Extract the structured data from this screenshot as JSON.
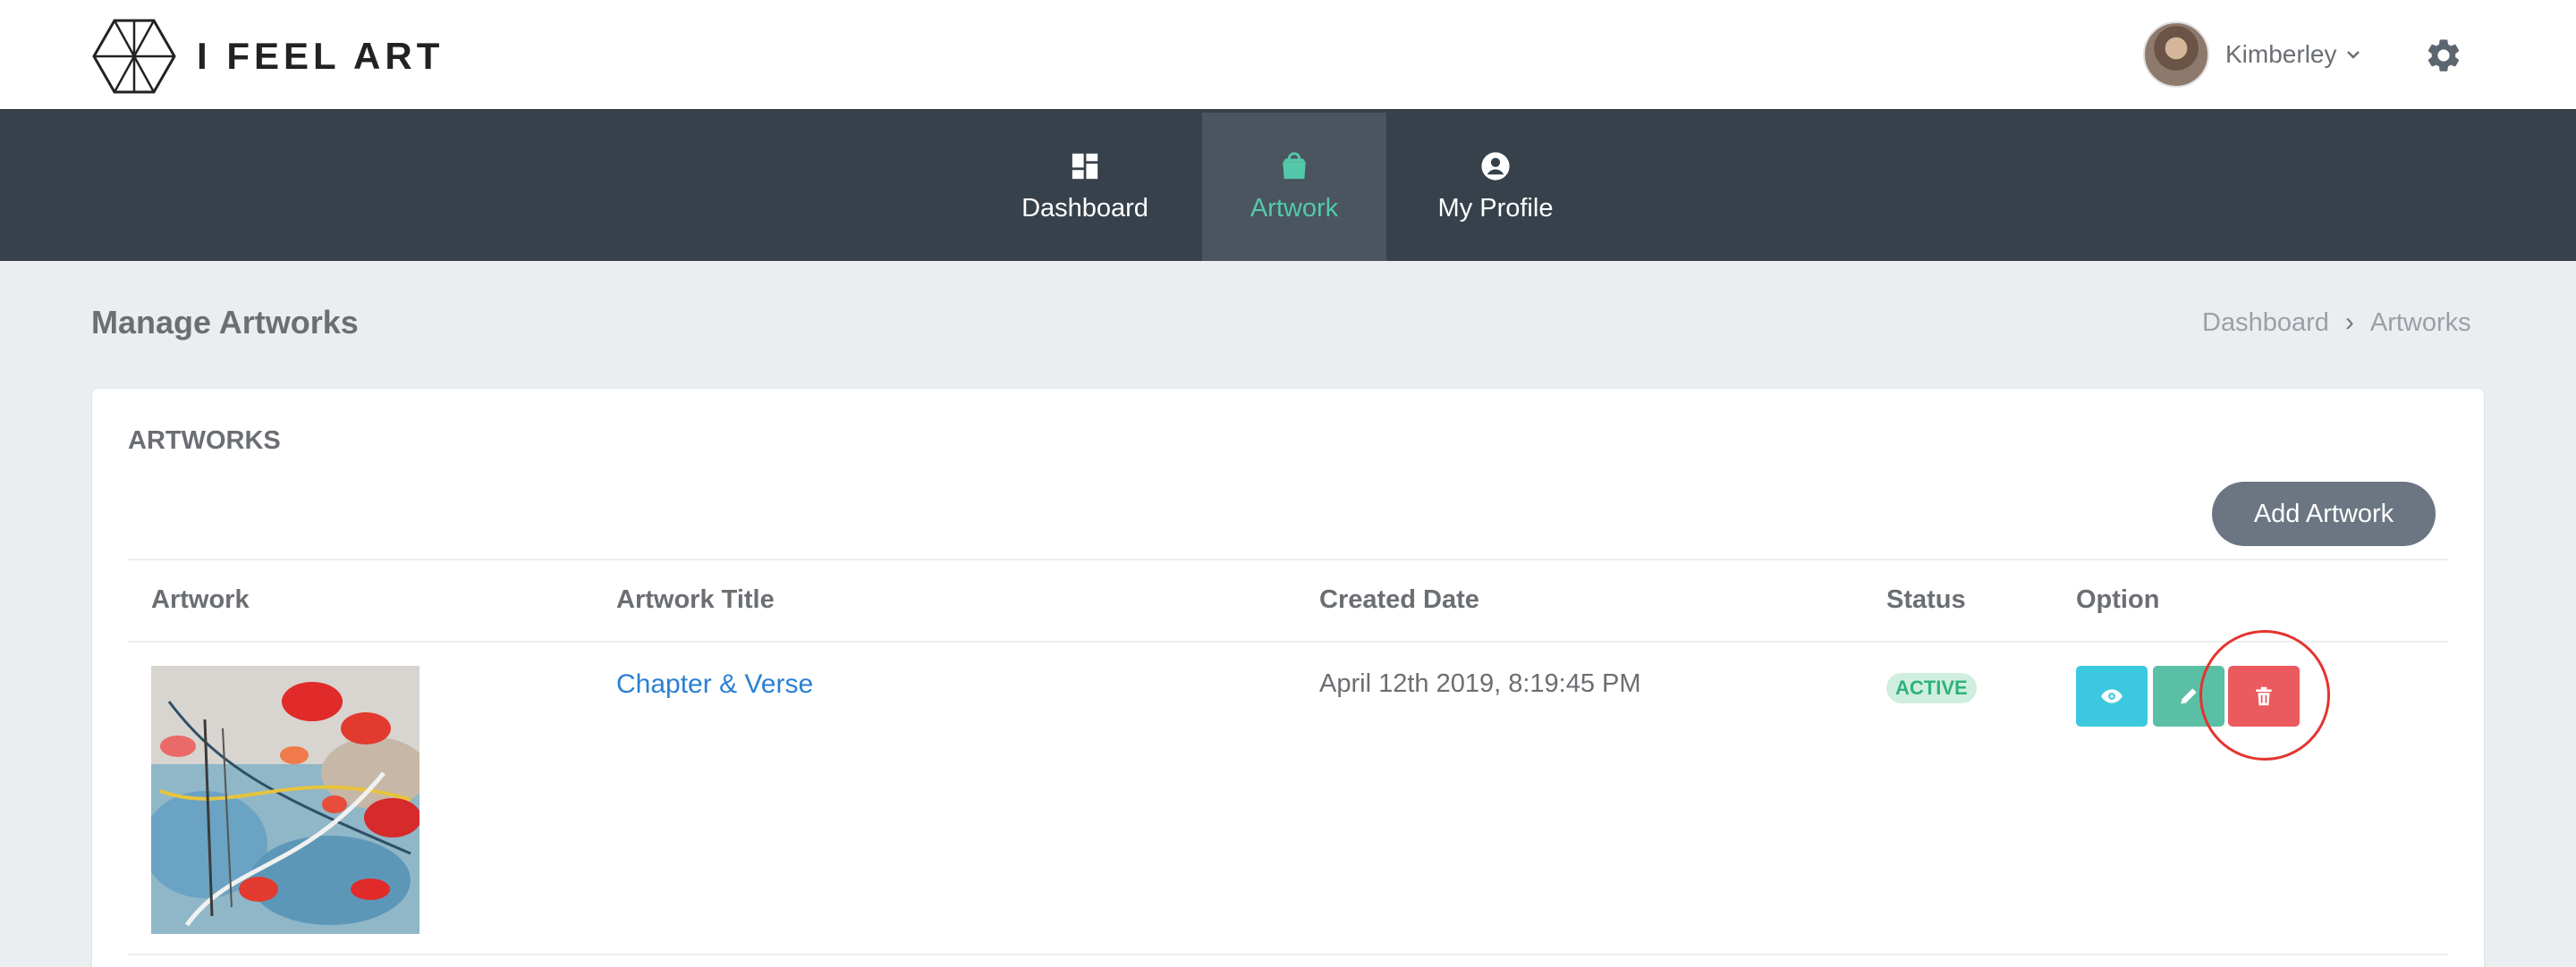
{
  "brand": {
    "name": "I FEEL ART"
  },
  "user": {
    "name": "Kimberley"
  },
  "nav": {
    "items": [
      {
        "label": "Dashboard",
        "icon": "dashboard-icon"
      },
      {
        "label": "Artwork",
        "icon": "shopping-bag-icon",
        "active": true
      },
      {
        "label": "My Profile",
        "icon": "user-circle-icon"
      }
    ]
  },
  "page": {
    "title": "Manage Artworks",
    "breadcrumb": [
      "Dashboard",
      "Artworks"
    ]
  },
  "card": {
    "title": "ARTWORKS",
    "add_button": "Add Artwork",
    "columns": [
      "Artwork",
      "Artwork Title",
      "Created Date",
      "Status",
      "Option"
    ],
    "rows": [
      {
        "title": "Chapter & Verse",
        "created": "April 12th 2019, 8:19:45 PM",
        "status": "ACTIVE"
      }
    ]
  },
  "colors": {
    "nav_bg": "#37414b",
    "accent": "#54c9a9",
    "view": "#3cc9df",
    "edit": "#5bbfa6",
    "delete": "#ea5a5f",
    "highlight_circle": "#e3342f"
  }
}
